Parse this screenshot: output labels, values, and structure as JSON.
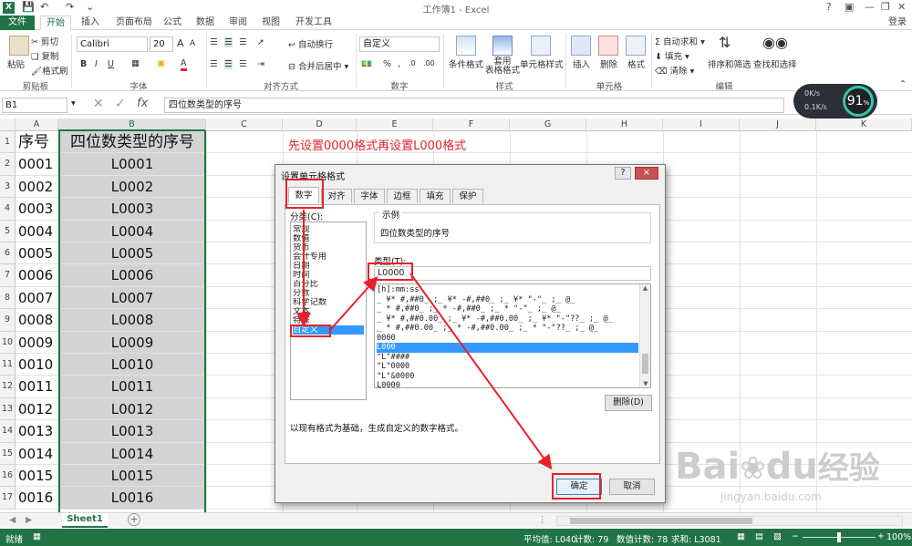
{
  "window": {
    "title": "工作簿1 - Excel",
    "login": "登录"
  },
  "ribbon_tabs": [
    "文件",
    "开始",
    "插入",
    "页面布局",
    "公式",
    "数据",
    "审阅",
    "视图",
    "开发工具"
  ],
  "clipboard": {
    "paste": "粘贴",
    "cut": "剪切",
    "copy": "复制",
    "format_painter": "格式刷",
    "label": "剪贴板"
  },
  "font": {
    "name": "Calibri",
    "size": "20",
    "label": "字体",
    "grow": "A",
    "shrink": "A"
  },
  "alignment": {
    "wrap": "自动换行",
    "merge": "合并后居中",
    "label": "对齐方式"
  },
  "number": {
    "format": "自定义",
    "label": "数字",
    "percent": "%",
    "comma": ","
  },
  "styles": {
    "conditional": "条件格式",
    "table": "套用\n表格格式",
    "cell_styles": "单元格样式",
    "label": "样式"
  },
  "cells": {
    "insert": "插入",
    "delete": "删除",
    "format": "格式",
    "label": "单元格"
  },
  "editing": {
    "autosum": "自动求和",
    "fill": "填充",
    "clear": "清除",
    "sort": "排序和筛选",
    "find": "查找和选择",
    "label": "编辑"
  },
  "formula_bar": {
    "name_box": "B1",
    "content": "四位数类型的序号",
    "fx": "fx"
  },
  "columns": [
    "A",
    "B",
    "C",
    "D",
    "E",
    "F",
    "G",
    "H",
    "I",
    "J",
    "K"
  ],
  "rows": [
    {
      "n": "1",
      "a": "序号",
      "b": "四位数类型的序号"
    },
    {
      "n": "2",
      "a": "0001",
      "b": "L0001"
    },
    {
      "n": "3",
      "a": "0002",
      "b": "L0002"
    },
    {
      "n": "4",
      "a": "0003",
      "b": "L0003"
    },
    {
      "n": "5",
      "a": "0004",
      "b": "L0004"
    },
    {
      "n": "6",
      "a": "0005",
      "b": "L0005"
    },
    {
      "n": "7",
      "a": "0006",
      "b": "L0006"
    },
    {
      "n": "8",
      "a": "0007",
      "b": "L0007"
    },
    {
      "n": "9",
      "a": "0008",
      "b": "L0008"
    },
    {
      "n": "10",
      "a": "0009",
      "b": "L0009"
    },
    {
      "n": "11",
      "a": "0010",
      "b": "L0010"
    },
    {
      "n": "12",
      "a": "0011",
      "b": "L0011"
    },
    {
      "n": "13",
      "a": "0012",
      "b": "L0012"
    },
    {
      "n": "14",
      "a": "0013",
      "b": "L0013"
    },
    {
      "n": "15",
      "a": "0014",
      "b": "L0014"
    },
    {
      "n": "16",
      "a": "0015",
      "b": "L0015"
    },
    {
      "n": "17",
      "a": "0016",
      "b": "L0016"
    }
  ],
  "annotation": "先设置0000格式再设置L000格式",
  "net_widget": {
    "percent": "91",
    "unit": "%",
    "up": "0K/s",
    "down": "0.1K/s"
  },
  "dialog": {
    "title": "设置单元格格式",
    "help": "?",
    "close": "×",
    "tabs": [
      "数字",
      "对齐",
      "字体",
      "边框",
      "填充",
      "保护"
    ],
    "category_label": "分类(C):",
    "categories": [
      "常规",
      "数值",
      "货币",
      "会计专用",
      "日期",
      "时间",
      "百分比",
      "分数",
      "科学记数",
      "文本",
      "特殊",
      "自定义"
    ],
    "sample_label": "示例",
    "sample": "四位数类型的序号",
    "type_label": "类型(T):",
    "type_value": "L0000",
    "type_list": [
      "[h]:mm:ss",
      "_ ¥* #,##0_ ;_ ¥* -#,##0_ ;_ ¥* \"-\"_ ;_ @_",
      "_ * #,##0_ ;_ * -#,##0_ ;_ * \"-\"_ ;_ @_",
      "_ ¥* #,##0.00_ ;_ ¥* -#,##0.00_ ;_ ¥* \"-\"??_ ;_ @_",
      "_ * #,##0.00_ ;_ * -#,##0.00_ ;_ * \"-\"??_ ;_ @_",
      "0000",
      "L000",
      "\"L\"####",
      "\"L\"0000",
      "\"L\"&0000",
      "L0000"
    ],
    "delete": "删除(D)",
    "description": "以现有格式为基础，生成自定义的数字格式。",
    "ok": "确定",
    "cancel": "取消"
  },
  "sheets": [
    "Sheet1"
  ],
  "add_sheet": "+",
  "status": {
    "ready": "就绪",
    "average": "平均值: L040",
    "count": "计数: 79",
    "numeric_count": "数值计数: 78",
    "sum": "求和: L3081",
    "zoom": "100%"
  },
  "watermark": {
    "brand": "Bai",
    "brand2": "du",
    "cn": "经验",
    "url": "jingyan.baidu.com"
  },
  "colors": {
    "excel_green": "#217346",
    "annotation_red": "#e8222a",
    "selection_blue": "#3399ff"
  }
}
